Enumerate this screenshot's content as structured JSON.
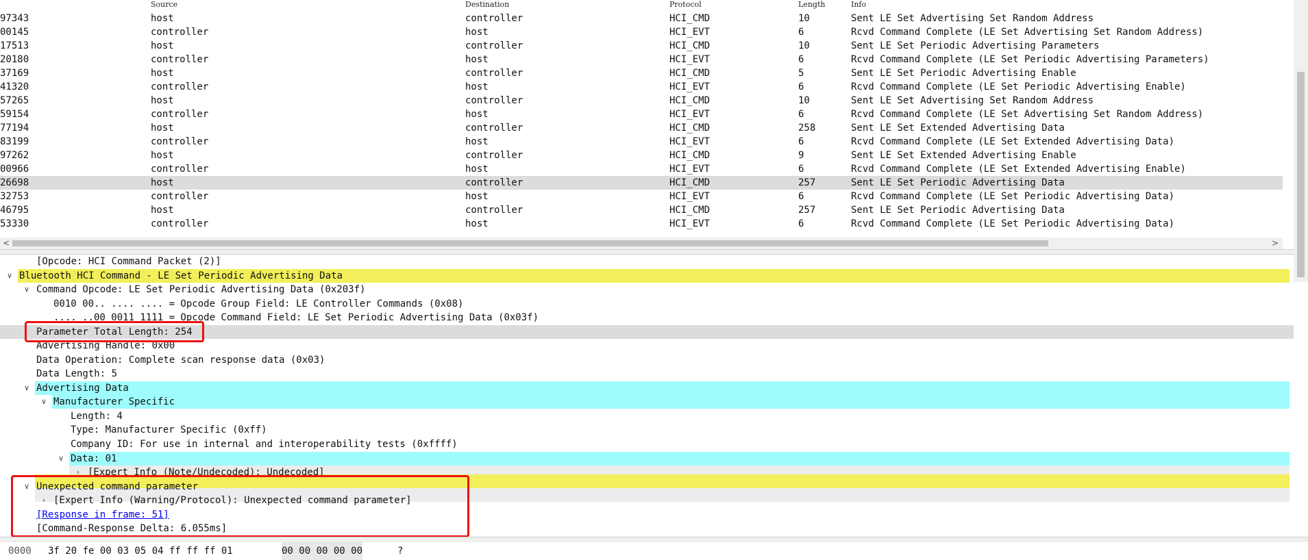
{
  "packet_list": {
    "columns": [
      "Source",
      "Destination",
      "Protocol",
      "Length",
      "Info"
    ],
    "rows": [
      {
        "no": "97343",
        "src": "host",
        "dst": "controller",
        "proto": "HCI_CMD",
        "len": "10",
        "info": "Sent LE Set Advertising Set Random Address"
      },
      {
        "no": "00145",
        "src": "controller",
        "dst": "host",
        "proto": "HCI_EVT",
        "len": "6",
        "info": "Rcvd Command Complete (LE Set Advertising Set Random Address)"
      },
      {
        "no": "17513",
        "src": "host",
        "dst": "controller",
        "proto": "HCI_CMD",
        "len": "10",
        "info": "Sent LE Set Periodic Advertising Parameters"
      },
      {
        "no": "20180",
        "src": "controller",
        "dst": "host",
        "proto": "HCI_EVT",
        "len": "6",
        "info": "Rcvd Command Complete (LE Set Periodic Advertising Parameters)"
      },
      {
        "no": "37169",
        "src": "host",
        "dst": "controller",
        "proto": "HCI_CMD",
        "len": "5",
        "info": "Sent LE Set Periodic Advertising Enable"
      },
      {
        "no": "41320",
        "src": "controller",
        "dst": "host",
        "proto": "HCI_EVT",
        "len": "6",
        "info": "Rcvd Command Complete (LE Set Periodic Advertising Enable)"
      },
      {
        "no": "57265",
        "src": "host",
        "dst": "controller",
        "proto": "HCI_CMD",
        "len": "10",
        "info": "Sent LE Set Advertising Set Random Address"
      },
      {
        "no": "59154",
        "src": "controller",
        "dst": "host",
        "proto": "HCI_EVT",
        "len": "6",
        "info": "Rcvd Command Complete (LE Set Advertising Set Random Address)"
      },
      {
        "no": "77194",
        "src": "host",
        "dst": "controller",
        "proto": "HCI_CMD",
        "len": "258",
        "info": "Sent LE Set Extended Advertising Data"
      },
      {
        "no": "83199",
        "src": "controller",
        "dst": "host",
        "proto": "HCI_EVT",
        "len": "6",
        "info": "Rcvd Command Complete (LE Set Extended Advertising Data)"
      },
      {
        "no": "97262",
        "src": "host",
        "dst": "controller",
        "proto": "HCI_CMD",
        "len": "9",
        "info": "Sent LE Set Extended Advertising Enable"
      },
      {
        "no": "00966",
        "src": "controller",
        "dst": "host",
        "proto": "HCI_EVT",
        "len": "6",
        "info": "Rcvd Command Complete (LE Set Extended Advertising Enable)"
      },
      {
        "no": "26698",
        "src": "host",
        "dst": "controller",
        "proto": "HCI_CMD",
        "len": "257",
        "info": "Sent LE Set Periodic Advertising Data",
        "selected": true
      },
      {
        "no": "32753",
        "src": "controller",
        "dst": "host",
        "proto": "HCI_EVT",
        "len": "6",
        "info": "Rcvd Command Complete (LE Set Periodic Advertising Data)"
      },
      {
        "no": "46795",
        "src": "host",
        "dst": "controller",
        "proto": "HCI_CMD",
        "len": "257",
        "info": "Sent LE Set Periodic Advertising Data"
      },
      {
        "no": "53330",
        "src": "controller",
        "dst": "host",
        "proto": "HCI_EVT",
        "len": "6",
        "info": "Rcvd Command Complete (LE Set Periodic Advertising Data)"
      }
    ],
    "scroll_left_arrow": "<",
    "scroll_right_arrow": ">"
  },
  "details": {
    "rows": [
      {
        "text": "[Opcode: HCI Command Packet (2)]",
        "toggle": ""
      },
      {
        "text": "Bluetooth HCI Command - LE Set Periodic Advertising Data",
        "toggle": "v"
      },
      {
        "text": "Command Opcode: LE Set Periodic Advertising Data (0x203f)",
        "toggle": "v"
      },
      {
        "text": "0010 00.. .... .... = Opcode Group Field: LE Controller Commands (0x08)",
        "toggle": ""
      },
      {
        "text": ".... ..00 0011 1111 = Opcode Command Field: LE Set Periodic Advertising Data (0x03f)",
        "toggle": ""
      },
      {
        "text": "Parameter Total Length: 254",
        "toggle": ""
      },
      {
        "text": "Advertising Handle: 0x00",
        "toggle": ""
      },
      {
        "text": "Data Operation: Complete scan response data (0x03)",
        "toggle": ""
      },
      {
        "text": "Data Length: 5",
        "toggle": ""
      },
      {
        "text": "Advertising Data",
        "toggle": "v"
      },
      {
        "text": "Manufacturer Specific",
        "toggle": "v"
      },
      {
        "text": "Length: 4",
        "toggle": ""
      },
      {
        "text": "Type: Manufacturer Specific (0xff)",
        "toggle": ""
      },
      {
        "text": "Company ID: For use in internal and interoperability tests (0xffff)",
        "toggle": ""
      },
      {
        "text": "Data: 01",
        "toggle": "v"
      },
      {
        "text": "[Expert Info (Note/Undecoded): Undecoded]",
        "toggle": ">"
      },
      {
        "text": "Unexpected command parameter",
        "toggle": "v"
      },
      {
        "text": "[Expert Info (Warning/Protocol): Unexpected command parameter]",
        "toggle": ">"
      },
      {
        "text": "[Response in frame: 51]",
        "toggle": ""
      },
      {
        "text": "[Command-Response Delta: 6.055ms]",
        "toggle": ""
      }
    ]
  },
  "bytes": {
    "offset": "0000",
    "hex_a": "3f 20 fe 00 03 05 04 ff  ff ff 01",
    "hex_b": "00 00 00 00 00",
    "ascii": "?"
  },
  "colors": {
    "selected_row": "#dcdcdc",
    "highlight_yellow": "#f2ef5a",
    "highlight_cyan": "#9ffcfc",
    "annotation_red": "#ee1111",
    "link": "#0000ee"
  }
}
